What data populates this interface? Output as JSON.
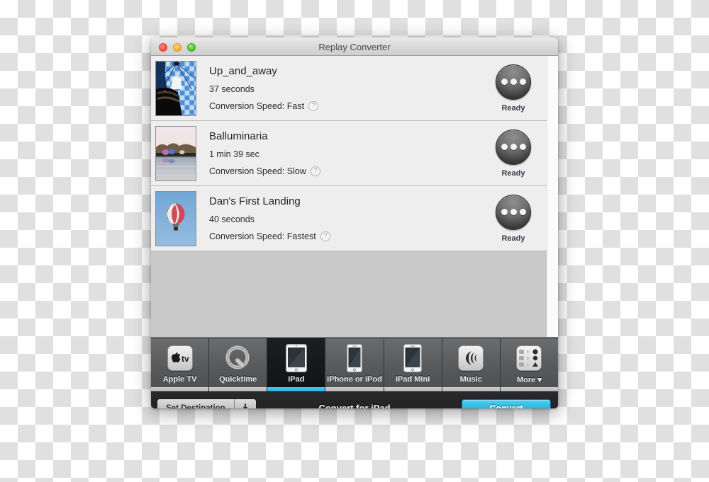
{
  "window": {
    "title": "Replay Converter",
    "traffic_lights": [
      {
        "name": "close",
        "color": "#f35347"
      },
      {
        "name": "minimize",
        "color": "#f7b43c"
      },
      {
        "name": "maximize",
        "color": "#4fc92e"
      }
    ]
  },
  "list": {
    "rows": [
      {
        "title": "Up_and_away",
        "duration": "37 seconds",
        "speed_label": "Conversion Speed: Fast",
        "help_glyph": "?",
        "status": "Ready",
        "thumbnail": "blue-checkered-balloon-thumbnail"
      },
      {
        "title": "Balluminaria",
        "duration": "1 min 39 sec",
        "speed_label": "Conversion Speed: Slow",
        "help_glyph": "?",
        "status": "Ready",
        "thumbnail": "lake-sunset-balloons-thumbnail"
      },
      {
        "title": "Dan's First Landing",
        "duration": "40 seconds",
        "speed_label": "Conversion Speed: Fastest",
        "help_glyph": "?",
        "status": "Ready",
        "thumbnail": "red-striped-balloon-sky-thumbnail"
      }
    ]
  },
  "device_tabs": {
    "selected": "iPad",
    "accent_color": "#2ab6e0",
    "items": [
      {
        "label": "Apple TV",
        "icon": "apple-tv-icon",
        "selected": false
      },
      {
        "label": "Quicktime",
        "icon": "quicktime-icon",
        "selected": false
      },
      {
        "label": "iPad",
        "icon": "ipad-icon",
        "selected": true
      },
      {
        "label": "iPhone or iPod",
        "icon": "iphone-icon",
        "selected": false
      },
      {
        "label": "iPad Mini",
        "icon": "ipad-mini-icon",
        "selected": false
      },
      {
        "label": "Music",
        "icon": "speaker-icon",
        "selected": false
      },
      {
        "label": "More ▾",
        "icon": "more-grid-icon",
        "selected": false
      }
    ]
  },
  "bottom_bar": {
    "set_destination_label": "Set Destination",
    "destination_icon": "save-to-disk-icon",
    "status_text": "Convert for iPad",
    "convert_label": "Convert"
  }
}
